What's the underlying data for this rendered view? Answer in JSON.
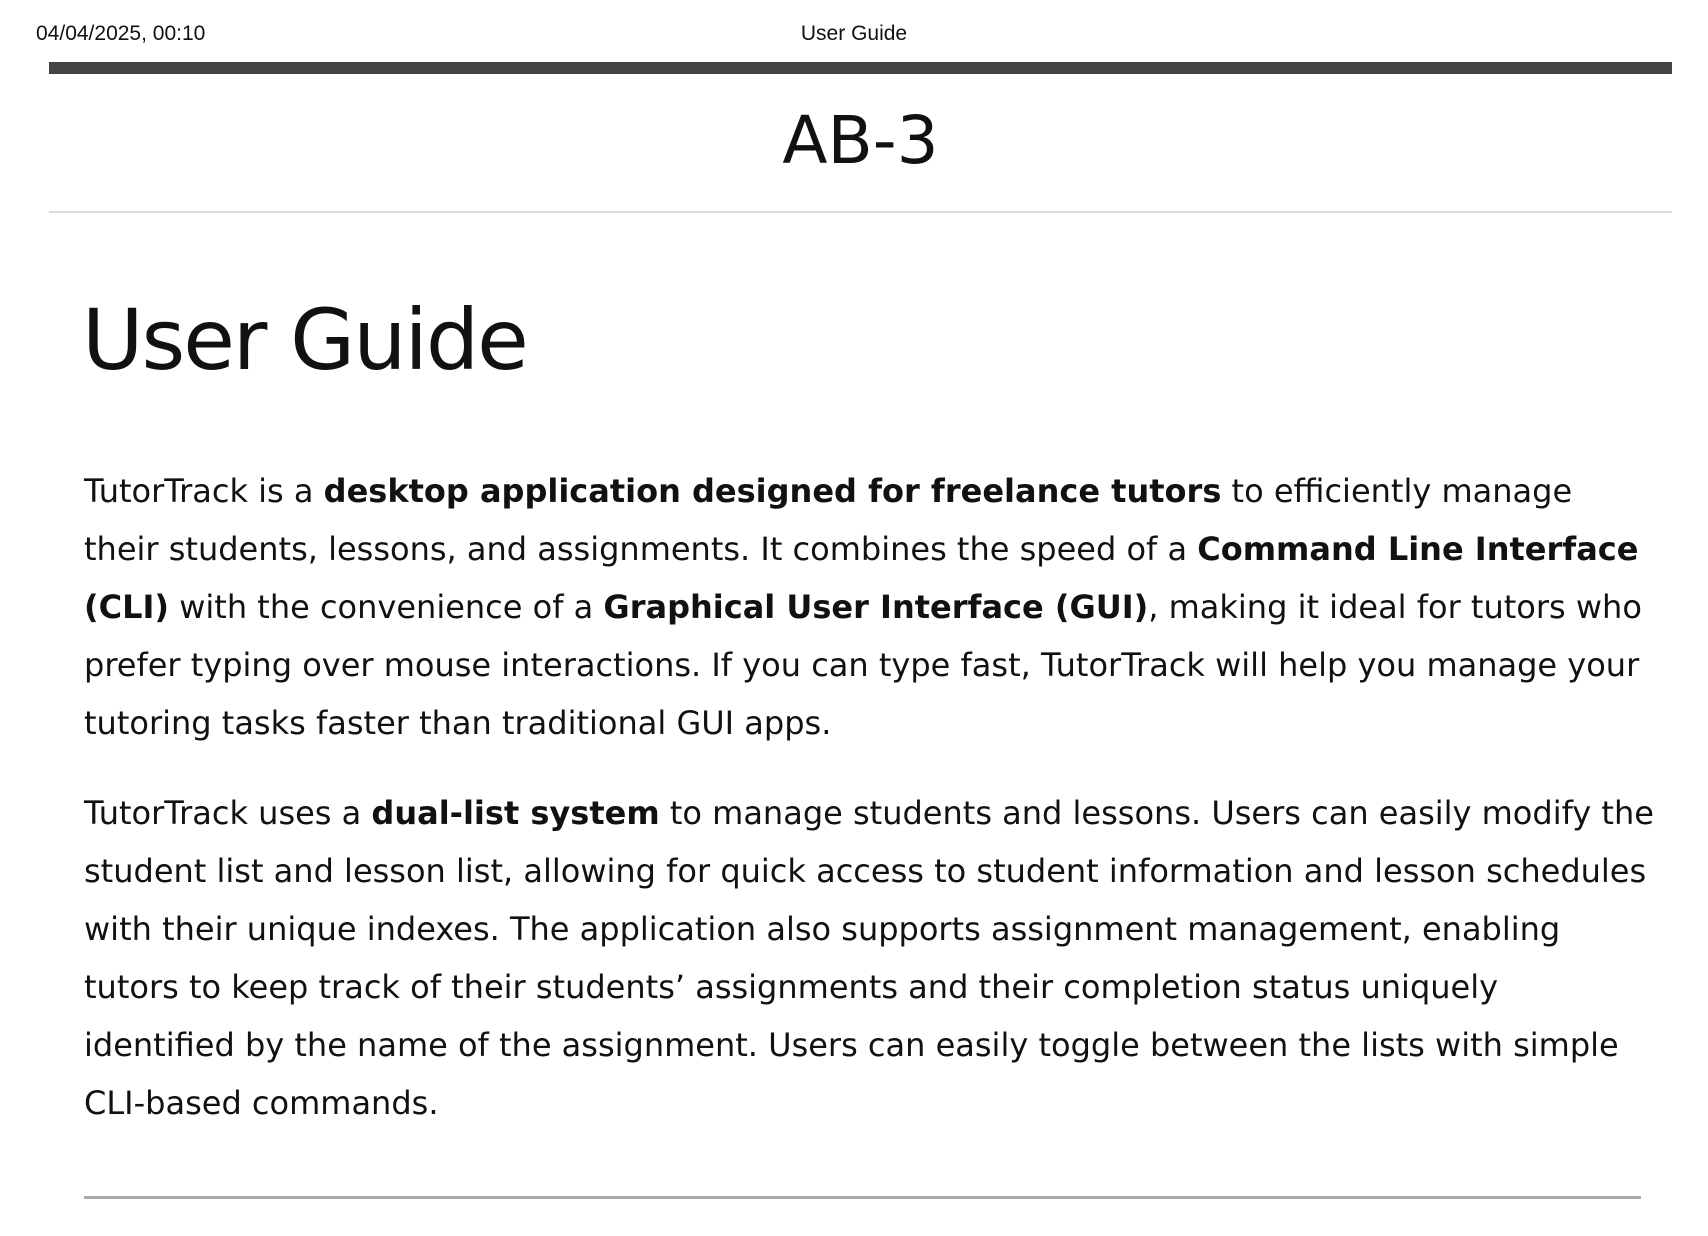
{
  "print_header": {
    "datetime": "04/04/2025, 00:10",
    "title": "User Guide"
  },
  "site": {
    "title": "AB-3"
  },
  "page": {
    "heading": "User Guide"
  },
  "paragraphs": [
    {
      "segments": [
        {
          "text": "TutorTrack is a ",
          "bold": false
        },
        {
          "text": "desktop application designed for freelance tutors",
          "bold": true
        },
        {
          "text": " to efficiently manage their students, lessons, and assignments. It combines the speed of a ",
          "bold": false
        },
        {
          "text": "Command Line Interface (CLI)",
          "bold": true
        },
        {
          "text": " with the convenience of a ",
          "bold": false
        },
        {
          "text": "Graphical User Interface (GUI)",
          "bold": true
        },
        {
          "text": ", making it ideal for tutors who prefer typing over mouse interactions. If you can type fast, TutorTrack will help you manage your tutoring tasks faster than traditional GUI apps.",
          "bold": false
        }
      ]
    },
    {
      "segments": [
        {
          "text": "TutorTrack uses a ",
          "bold": false
        },
        {
          "text": "dual-list system",
          "bold": true
        },
        {
          "text": " to manage students and lessons. Users can easily modify the student list and lesson list, allowing for quick access to student information and lesson schedules with their unique indexes. The application also supports assignment management, enabling tutors to keep track of their students’ assignments and their completion status uniquely identified by the name of the assignment. Users can easily toggle between the lists with simple CLI-based commands.",
          "bold": false
        }
      ]
    }
  ]
}
